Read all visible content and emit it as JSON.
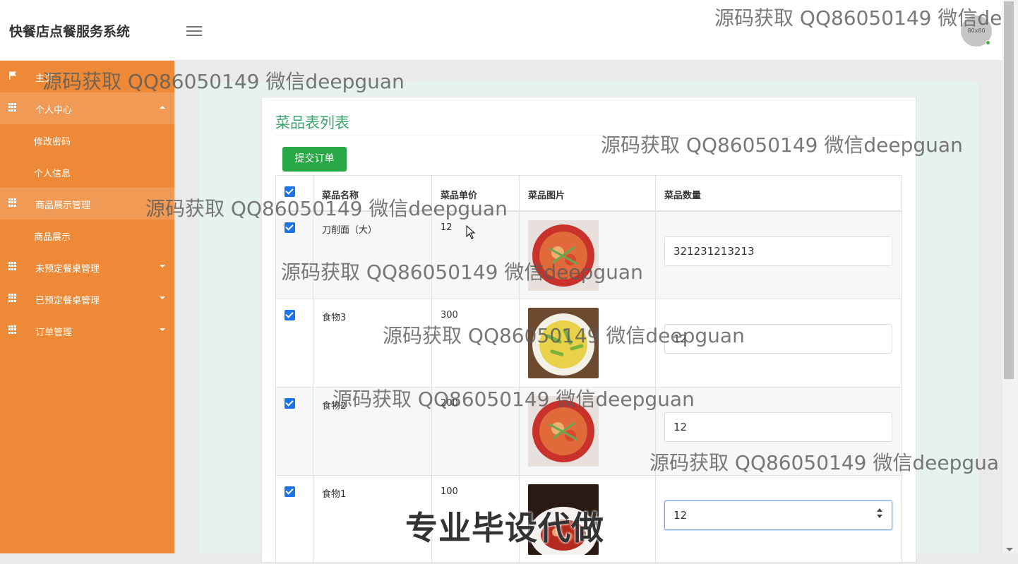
{
  "app": {
    "title": "快餐店点餐服务系统",
    "avatar_text": "80x80"
  },
  "sidebar": {
    "items": [
      {
        "label": "主页",
        "icon": "flag-icon"
      },
      {
        "label": "个人中心",
        "icon": "grid-icon",
        "expanded": true
      },
      {
        "label": "修改密码"
      },
      {
        "label": "个人信息"
      },
      {
        "label": "商品展示管理",
        "icon": "grid-icon",
        "expanded": true
      },
      {
        "label": "商品展示"
      },
      {
        "label": "未预定餐桌管理",
        "icon": "grid-icon"
      },
      {
        "label": "已预定餐桌管理",
        "icon": "grid-icon"
      },
      {
        "label": "订单管理",
        "icon": "grid-icon"
      }
    ]
  },
  "main": {
    "title": "菜品表列表",
    "submit_label": "提交订单",
    "columns": [
      "菜品名称",
      "菜品单价",
      "菜品图片",
      "菜品数量"
    ],
    "rows": [
      {
        "name": "刀削面（大）",
        "price": "12",
        "qty": "321231213213",
        "image": "tomato-noodle-bowl"
      },
      {
        "name": "食物3",
        "price": "300",
        "qty": "12",
        "image": "egg-pepper-bowl"
      },
      {
        "name": "食物2",
        "price": "200",
        "qty": "12",
        "image": "tomato-noodle-bowl"
      },
      {
        "name": "食物1",
        "price": "100",
        "qty": "12",
        "image": "meat-plate"
      }
    ]
  },
  "watermarks": {
    "text": "源码获取 QQ86050149 微信deepguan",
    "truncated_top": "源码获取 QQ86050149 微信de",
    "truncated_right": "源码获取 QQ86050149 微信deepgua",
    "big": "专业毕设代做"
  },
  "colors": {
    "sidebar": "#ee8a37",
    "accent_green": "#28a745",
    "title_green": "#3aa56b",
    "checkbox": "#1a73e8"
  }
}
